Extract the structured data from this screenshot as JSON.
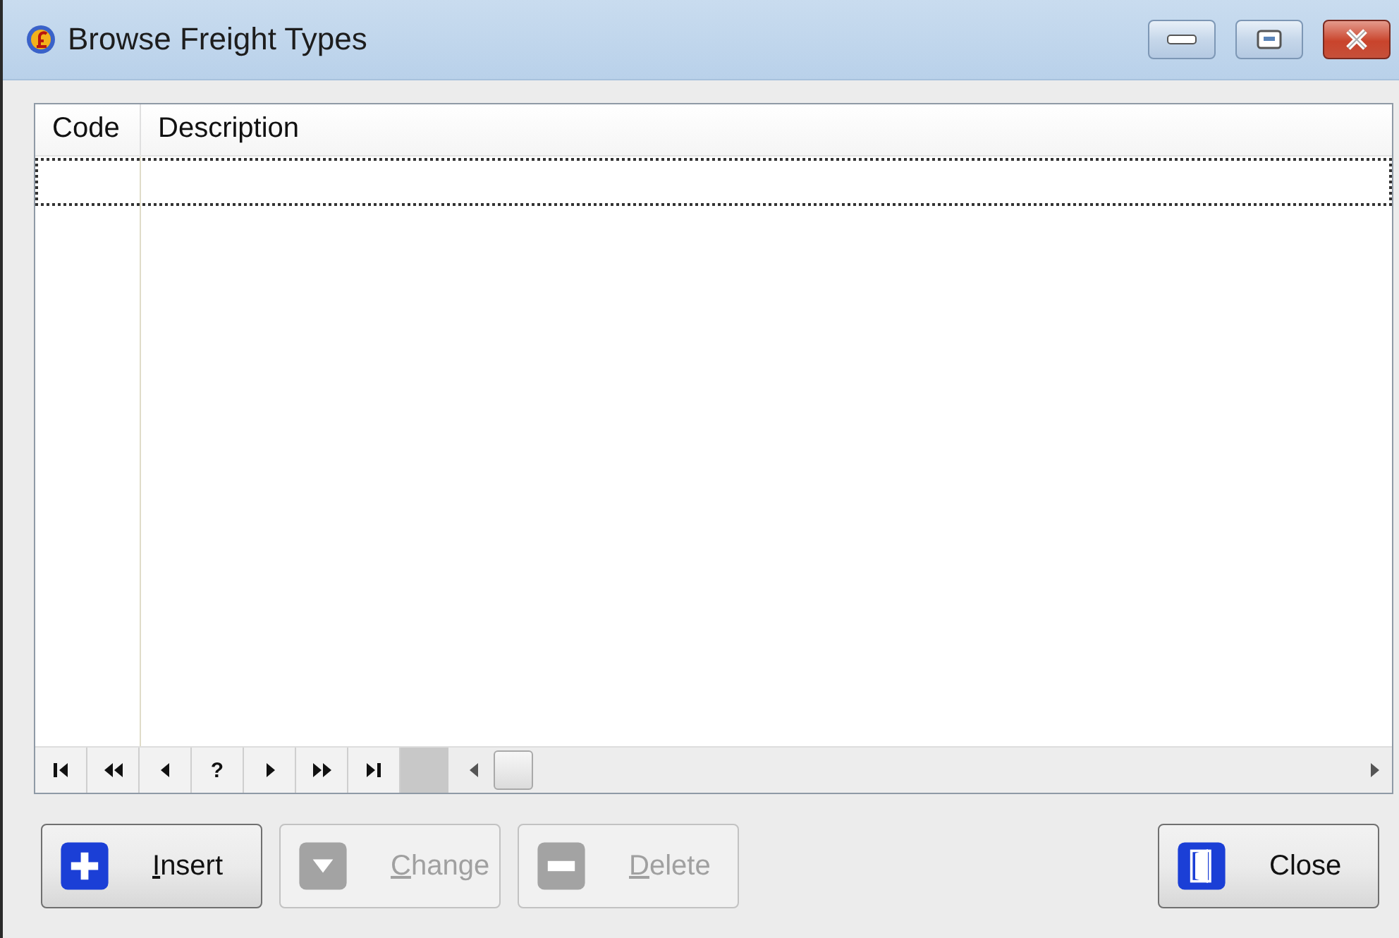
{
  "window": {
    "title": "Browse Freight Types"
  },
  "table": {
    "columns": [
      "Code",
      "Description"
    ],
    "new_row": {
      "focused": true
    }
  },
  "navigator": [
    {
      "kind": "first"
    },
    {
      "kind": "page_back"
    },
    {
      "kind": "prev"
    },
    {
      "kind": "query",
      "label": "?"
    },
    {
      "kind": "next"
    },
    {
      "kind": "page_forward"
    },
    {
      "kind": "last"
    }
  ],
  "buttons": [
    {
      "kind": "insert",
      "label": "Insert",
      "disabled": false,
      "underline_first": true
    },
    {
      "kind": "change",
      "label": "Change",
      "disabled": true,
      "underline_first": true
    },
    {
      "kind": "delete",
      "label": "Delete",
      "disabled": true,
      "underline_first": true
    },
    {
      "kind": "close",
      "label": "Close",
      "disabled": false,
      "underline_first": false
    }
  ]
}
